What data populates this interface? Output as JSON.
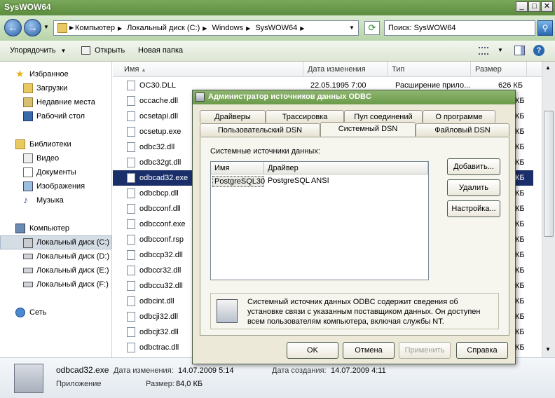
{
  "explorer": {
    "title": "SysWOW64",
    "breadcrumbs": [
      "Компьютер",
      "Локальный диск (C:)",
      "Windows",
      "SysWOW64"
    ],
    "search_placeholder": "Поиск: SysWOW64",
    "toolbar": {
      "organize": "Упорядочить",
      "open": "Открыть",
      "new_folder": "Новая папка"
    },
    "sidebar": {
      "favorites": "Избранное",
      "downloads": "Загрузки",
      "recent": "Недавние места",
      "desktop": "Рабочий стол",
      "libraries": "Библиотеки",
      "videos": "Видео",
      "documents": "Документы",
      "pictures": "Изображения",
      "music": "Музыка",
      "computer": "Компьютер",
      "disk_c": "Локальный диск (C:)",
      "disk_d": "Локальный диск (D:)",
      "disk_e": "Локальный диск (E:)",
      "disk_f": "Локальный диск (F:)",
      "network": "Сеть"
    },
    "columns": {
      "name": "Имя",
      "modified": "Дата изменения",
      "type": "Тип",
      "size": "Размер"
    },
    "first_row": {
      "date": "22.05.1995 7:00",
      "type": "Расширение прило...",
      "size": "626 КБ"
    },
    "files": [
      "OC30.DLL",
      "occache.dll",
      "ocsetapi.dll",
      "ocsetup.exe",
      "odbc32.dll",
      "odbc32gt.dll",
      "odbcad32.exe",
      "odbcbcp.dll",
      "odbcconf.dll",
      "odbcconf.exe",
      "odbcconf.rsp",
      "odbccp32.dll",
      "odbccr32.dll",
      "odbccu32.dll",
      "odbcint.dll",
      "odbcji32.dll",
      "odbcjt32.dll",
      "odbctrac.dll"
    ],
    "size_suffix": "КБ",
    "status": {
      "filename": "odbcad32.exe",
      "modified_label": "Дата изменения:",
      "modified_value": "14.07.2009 5:14",
      "created_label": "Дата создания:",
      "created_value": "14.07.2009 4:11",
      "type": "Приложение",
      "size_label": "Размер:",
      "size_value": "84,0 КБ"
    }
  },
  "dialog": {
    "title": "Администратор источников данных ODBC",
    "tabs_row1": [
      "Драйверы",
      "Трассировка",
      "Пул соединений",
      "О программе"
    ],
    "tabs_row2": [
      "Пользовательский DSN",
      "Системный DSN",
      "Файловый DSN"
    ],
    "section_label": "Системные источники данных:",
    "list_columns": {
      "name": "Имя",
      "driver": "Драйвер"
    },
    "list_rows": [
      {
        "name": "PostgreSQL30",
        "driver": "PostgreSQL ANSI"
      }
    ],
    "buttons": {
      "add": "Добавить...",
      "remove": "Удалить",
      "configure": "Настройка..."
    },
    "info_text": [
      "Системный источник данных ODBC содержит сведения об",
      "установке связи с указанным поставщиком данных. Он доступен",
      "всем пользователям компьютера, включая службы NT."
    ],
    "footer": {
      "ok": "OK",
      "cancel": "Отмена",
      "apply": "Применить",
      "help": "Справка"
    }
  }
}
